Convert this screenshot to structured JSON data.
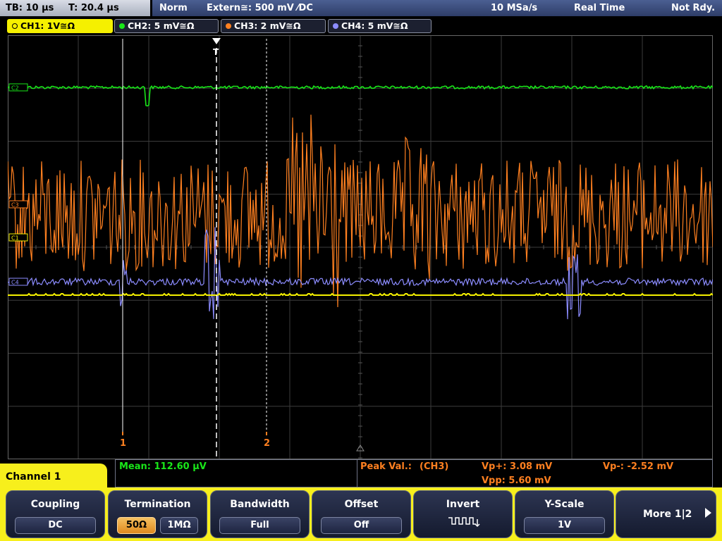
{
  "topbar": {
    "timebase": "TB: 10 µs",
    "trigger_time": "T: 20.4 µs",
    "trigger_mode": "Norm",
    "trigger_source": "Extern≅: 500 mV ⁄DC",
    "sample_rate": "10 MSa/s",
    "acq_mode": "Real Time",
    "status": "Not Rdy."
  },
  "channels": [
    {
      "id": "ch1",
      "label": "CH1: 1V≅Ω",
      "color": "#f5f000"
    },
    {
      "id": "ch2",
      "label": "CH2: 5 mV≅Ω",
      "color": "#19e619"
    },
    {
      "id": "ch3",
      "label": "CH3: 2 mV≅Ω",
      "color": "#ff8020"
    },
    {
      "id": "ch4",
      "label": "CH4: 5 mV≅Ω",
      "color": "#8c8cff"
    }
  ],
  "markers": {
    "ch2": "C2",
    "ch3": "C3",
    "ch1": "C1",
    "ch4": "C4",
    "trigger": "T",
    "cursor1": "1",
    "cursor2": "2"
  },
  "measurements": {
    "mean": "Mean: 112.60 µV",
    "peak_label": "Peak Val.:",
    "peak_source": "(CH3)",
    "vp_plus": "Vp+: 3.08 mV",
    "vp_minus": "Vp-: -2.52 mV",
    "vpp": "Vpp: 5.60 mV"
  },
  "channel_menu_title": "Channel 1",
  "softkeys": {
    "coupling": {
      "title": "Coupling",
      "value": "DC"
    },
    "termination": {
      "title": "Termination",
      "opt1": "50Ω",
      "opt2": "1MΩ",
      "selected": "50Ω"
    },
    "bandwidth": {
      "title": "Bandwidth",
      "value": "Full"
    },
    "offset": {
      "title": "Offset",
      "value": "Off"
    },
    "invert": {
      "title": "Invert",
      "icon": "invert-waveform-icon"
    },
    "yscale": {
      "title": "Y-Scale",
      "value": "1V"
    },
    "more": {
      "label": "More 1|2",
      "icon": "right-arrow-icon"
    }
  },
  "colors": {
    "ch1": "#f5f000",
    "ch2": "#19e619",
    "ch3": "#ff8020",
    "ch4": "#8c8cff",
    "grid": "#3c3c3c",
    "softkey_bar": "#f7ef1c",
    "header": "#3a4a7c"
  }
}
